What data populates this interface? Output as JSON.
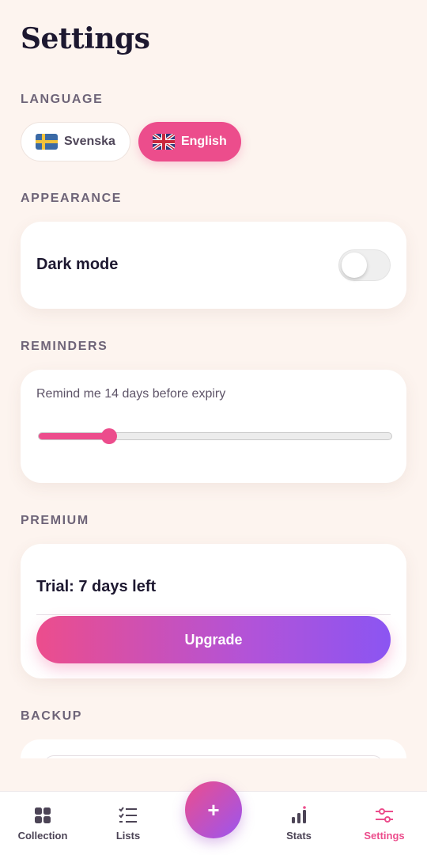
{
  "header": {
    "title": "Settings"
  },
  "language": {
    "section_label": "LANGUAGE",
    "options": [
      {
        "label": "Svenska",
        "flag": "sweden-flag-icon",
        "selected": false
      },
      {
        "label": "English",
        "flag": "uk-flag-icon",
        "selected": true
      }
    ]
  },
  "appearance": {
    "section_label": "APPEARANCE",
    "dark_mode_label": "Dark mode",
    "dark_mode_on": false
  },
  "reminders": {
    "section_label": "REMINDERS",
    "text": "Remind me 14 days before expiry",
    "slider_fraction": 0.2
  },
  "premium": {
    "section_label": "PREMIUM",
    "trial_text": "Trial: 7 days left",
    "upgrade_label": "Upgrade"
  },
  "backup": {
    "section_label": "BACKUP"
  },
  "tabbar": {
    "fab_label": "+",
    "tabs": [
      {
        "label": "Collection",
        "icon": "grid-icon",
        "active": false
      },
      {
        "label": "Lists",
        "icon": "checklist-icon",
        "active": false
      },
      {
        "label": "Stats",
        "icon": "bar-chart-icon",
        "active": false
      },
      {
        "label": "Settings",
        "icon": "sliders-icon",
        "active": true
      }
    ]
  },
  "colors": {
    "accent": "#ec4d8c",
    "accent_purple": "#8b55f2",
    "background": "#fdf4ef"
  }
}
